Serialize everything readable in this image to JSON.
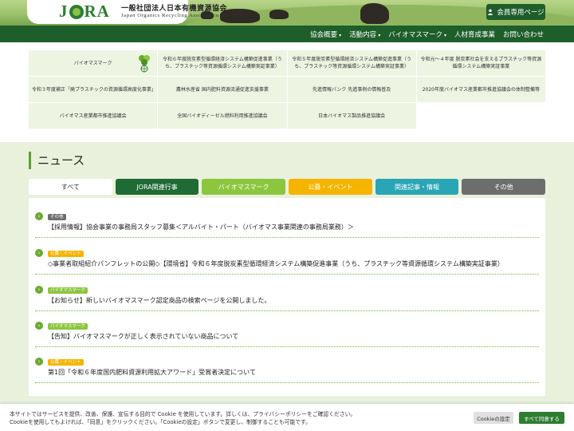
{
  "header": {
    "logo_text": "JORA",
    "org_name_jp": "一般社団法人日本有機資源協会",
    "org_name_en": "Japan Organics Recycling Association",
    "member_button": "会員専用ページ"
  },
  "nav": {
    "items": [
      {
        "label": "協会概要",
        "caret": "▾"
      },
      {
        "label": "活動内容",
        "caret": "▾"
      },
      {
        "label": "バイオマスマーク",
        "caret": "▾"
      },
      {
        "label": "人材育成事業",
        "caret": ""
      },
      {
        "label": "お問い合わせ",
        "caret": ""
      }
    ]
  },
  "links": [
    "バイオマスマーク",
    "令和６年度脱炭素型循環経済システム構築促進事業（うち、プラスチック等資源循環システム構築実証事業）",
    "令和５年度脱炭素型循環経済システム構築促進事業（うち、プラスチック等資源循環システム構築実証事業）",
    "令和元～４年度 脱炭素社会を支えるプラスチック等資源循環システム構築実証事業",
    "令和３年度補正「廃プラスチックの資源循環高度化事業」",
    "農林水産省 国内肥料資源流通促進支援事業",
    "先進情報バンク 先進事例の情報普及",
    "2020年度バイオマス産業都市推進協議会の体制整備等",
    "バイオマス産業都市推進協議会",
    "全国バイオディーゼル燃料利用推進協議会",
    "日本バイオマス製品推進協議会"
  ],
  "news": {
    "title": "ニュース",
    "tabs": [
      {
        "label": "すべて",
        "color": "#ffffff",
        "text_color": "#333333"
      },
      {
        "label": "JORA関連行事",
        "color": "#1e6b35",
        "text_color": "#ffffff"
      },
      {
        "label": "バイオマスマーク",
        "color": "#8cc63f",
        "text_color": "#ffffff"
      },
      {
        "label": "公募・イベント",
        "color": "#f5b400",
        "text_color": "#ffffff"
      },
      {
        "label": "関連記事・情報",
        "color": "#2aa5b5",
        "text_color": "#ffffff"
      },
      {
        "label": "その他",
        "color": "#6d6d6d",
        "text_color": "#ffffff"
      }
    ],
    "items": [
      {
        "badge": "その他",
        "badge_color": "#6d6d6d",
        "headline": "【採用情報】協会事業の事務局スタッフ募集＜アルバイト・パート（バイオマス事業関連の事務局業務）＞"
      },
      {
        "badge": "公募・イベント",
        "badge_color": "#f5b400",
        "headline": "◇事業者取組紹介パンフレットの公開◇【環境省】令和６年度脱炭素型循環経済システム構築促進事業（うち、プラスチック等資源循環システム構築実証事業）"
      },
      {
        "badge": "バイオマスマーク",
        "badge_color": "#8cc63f",
        "headline": "【お知らせ】新しいバイオマスマーク認定商品の検索ページを公開しました。"
      },
      {
        "badge": "バイオマスマーク",
        "badge_color": "#8cc63f",
        "headline": "【告知】バイオマスマークが正しく表示されていない商品について"
      },
      {
        "badge": "公募・イベント",
        "badge_color": "#f5b400",
        "headline": "第1回「令和６年度国内肥料資源利用拡大アワード」受賞者決定について"
      }
    ]
  },
  "cookie": {
    "line1": "本サイトではサービスを提供、改善、保護、宣伝する目的で Cookie を使用しています。詳しくは、プライバシーポリシーをご確認ください。",
    "line2": "Cookieを使用してもよければ、「同意」をクリックください。「Cookieの設定」ボタンで変更し、制御することも可能です。",
    "settings_button": "Cookieの設定",
    "accept_button": "すべて同意する"
  }
}
